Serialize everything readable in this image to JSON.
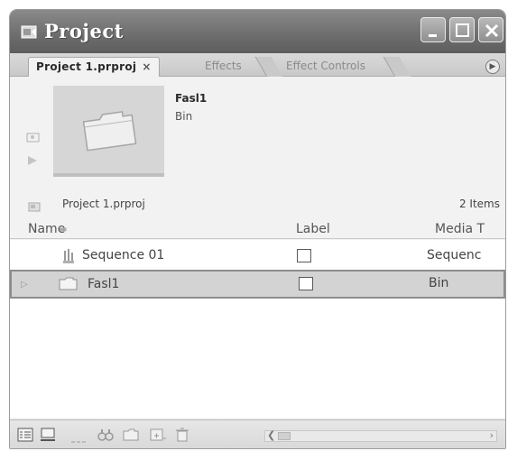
{
  "window": {
    "title": "Project"
  },
  "tabs": [
    {
      "label": "Project 1.prproj",
      "close": "×"
    },
    {
      "label": "Effects"
    },
    {
      "label": "Effect Controls"
    }
  ],
  "preview": {
    "name": "Fasl1",
    "type": "Bin"
  },
  "project": {
    "name": "Project 1.prproj",
    "items_count": "2 Items"
  },
  "columns": {
    "name": "Name",
    "label": "Label",
    "media_type": "Media T"
  },
  "rows": [
    {
      "name": "Sequence 01",
      "media": "Sequenc",
      "icon": "sequence-icon"
    },
    {
      "name": "Fasl1",
      "media": "Bin",
      "icon": "folder-icon",
      "selected": true
    }
  ]
}
